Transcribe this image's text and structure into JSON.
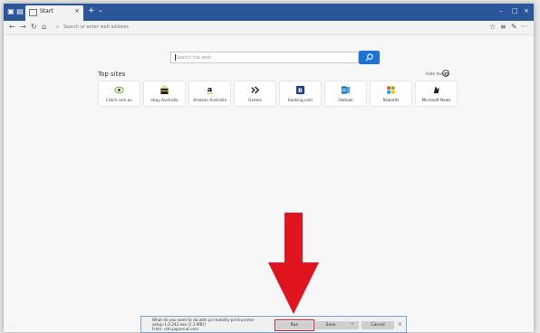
{
  "browser": {
    "tab_title": "Start",
    "new_tab_symbol": "+",
    "tab_menu_symbol": "⌄",
    "close_symbol": "×",
    "window_controls": {
      "minimize": "–",
      "maximize": "□",
      "close": "×"
    }
  },
  "addressbar": {
    "placeholder": "Search or enter web address",
    "back": "←",
    "forward": "→",
    "refresh": "↻",
    "home": "⌂",
    "favorites": "☆",
    "reading_list": "≡",
    "notes": "✎",
    "more": "···"
  },
  "search": {
    "placeholder": "Search the web",
    "icon": "search-icon"
  },
  "topsites": {
    "label": "Top sites",
    "hide_feed": "Hide feed",
    "items": [
      {
        "label": "Catch.com.au",
        "icon": "catch-icon",
        "color": "#7bb93a"
      },
      {
        "label": "ebay Australia",
        "icon": "ebay-bag-icon",
        "color": "#e8b400"
      },
      {
        "label": "Amazon Australia",
        "icon": "amazon-icon",
        "color": "#111111"
      },
      {
        "label": "Games",
        "icon": "games-icon",
        "color": "#222222"
      },
      {
        "label": "booking.com",
        "icon": "booking-icon",
        "color": "#1f3f8a"
      },
      {
        "label": "Outlook",
        "icon": "outlook-icon",
        "color": "#0f6bc7"
      },
      {
        "label": "Rewards",
        "icon": "rewards-icon",
        "color": "#f25022"
      },
      {
        "label": "Microsoft News",
        "icon": "news-icon",
        "color": "#222222"
      }
    ]
  },
  "download": {
    "line1": "What do you want to do with pc-mobility-print-printer-",
    "line2": "setup-1.0.242.exe (2.3 MB)?",
    "line3": "From: cdn.papercut.com",
    "run": "Run",
    "save": "Save",
    "save_menu": "^",
    "cancel": "Cancel",
    "close": "×"
  },
  "colors": {
    "accent": "#2b579a",
    "search_button": "#1a73d9",
    "arrow": "#e0141e",
    "highlight": "#e0141e"
  }
}
